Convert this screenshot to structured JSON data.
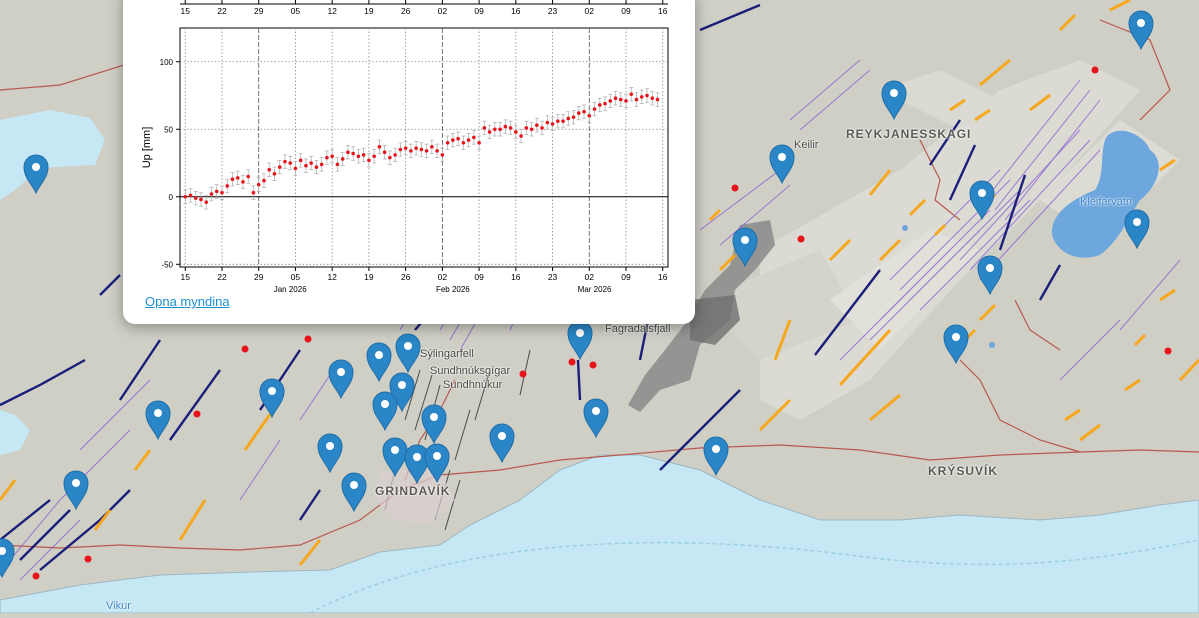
{
  "map": {
    "place_labels": [
      {
        "name": "REYKJANESSKAGI",
        "kind": "region"
      },
      {
        "name": "Keilir",
        "kind": "small"
      },
      {
        "name": "Kleifarvatn",
        "kind": "water"
      },
      {
        "name": "KRÝSUVÍK",
        "kind": "region"
      },
      {
        "name": "GRINDAVÍK",
        "kind": "region"
      },
      {
        "name": "Sýlingarfell",
        "kind": "small"
      },
      {
        "name": "Sundhnúksgígar",
        "kind": "small"
      },
      {
        "name": "Sundhnúkur",
        "kind": "small"
      },
      {
        "name": "Fagradalsfjall",
        "kind": "small"
      },
      {
        "name": "Vikur",
        "kind": "water"
      }
    ],
    "colors": {
      "land": "#cfcfc6",
      "sea": "#c6e8f5",
      "lake": "#6ea6de",
      "lava": "#7e7e7e",
      "fault_navy": "#1b1f7a",
      "fault_purple": "#8b5fd3",
      "fissure_orange": "#f7a71b",
      "road": "#b8584e",
      "quake_dot": "#e8141b",
      "marker": "#2a86c6"
    },
    "markers_icon": "map-marker-icon"
  },
  "popup": {
    "link_text": "Opna myndina",
    "chart_data": {
      "type": "scatter",
      "title": "",
      "xlabel": "",
      "ylabel": "Up [mm]",
      "ylim": [
        -52,
        125
      ],
      "yticks": [
        -50,
        0,
        50,
        100
      ],
      "xlim_days": [
        -1,
        76
      ],
      "x_day_ticks": [
        {
          "label": "15",
          "day": 0
        },
        {
          "label": "22",
          "day": 7
        },
        {
          "label": "29",
          "day": 14
        },
        {
          "label": "05",
          "day": 21
        },
        {
          "label": "12",
          "day": 28
        },
        {
          "label": "19",
          "day": 35
        },
        {
          "label": "26",
          "day": 42
        },
        {
          "label": "02",
          "day": 49
        },
        {
          "label": "09",
          "day": 56
        },
        {
          "label": "16",
          "day": 63
        },
        {
          "label": "23",
          "day": 70
        },
        {
          "label": "02",
          "day": 77
        },
        {
          "label": "09",
          "day": 84
        },
        {
          "label": "16",
          "day": 91
        }
      ],
      "month_labels": [
        {
          "label": "Jan 2026",
          "day": 20
        },
        {
          "label": "Feb 2026",
          "day": 51
        },
        {
          "label": "Mar 2026",
          "day": 78
        }
      ],
      "start_date": "2025-12-15",
      "series": [
        {
          "name": "",
          "color": "#e8141b",
          "error_mm": 5,
          "points": [
            [
              1,
              0
            ],
            [
              2,
              1
            ],
            [
              3,
              -1
            ],
            [
              4,
              -2
            ],
            [
              5,
              -4
            ],
            [
              6,
              2
            ],
            [
              7,
              4
            ],
            [
              8,
              3
            ],
            [
              9,
              8
            ],
            [
              10,
              13
            ],
            [
              11,
              14
            ],
            [
              12,
              11
            ],
            [
              13,
              15
            ],
            [
              14,
              3
            ],
            [
              15,
              9
            ],
            [
              16,
              12
            ],
            [
              17,
              20
            ],
            [
              18,
              17
            ],
            [
              19,
              22
            ],
            [
              20,
              26
            ],
            [
              21,
              25
            ],
            [
              22,
              21
            ],
            [
              23,
              27
            ],
            [
              24,
              23
            ],
            [
              25,
              25
            ],
            [
              26,
              22
            ],
            [
              27,
              24
            ],
            [
              28,
              29
            ],
            [
              29,
              30
            ],
            [
              30,
              24
            ],
            [
              31,
              28
            ],
            [
              32,
              33
            ],
            [
              33,
              32
            ],
            [
              34,
              30
            ],
            [
              35,
              31
            ],
            [
              36,
              27
            ],
            [
              37,
              30
            ],
            [
              38,
              37
            ],
            [
              39,
              33
            ],
            [
              40,
              29
            ],
            [
              41,
              31
            ],
            [
              42,
              35
            ],
            [
              43,
              36
            ],
            [
              44,
              34
            ],
            [
              45,
              36
            ],
            [
              46,
              35
            ],
            [
              47,
              34
            ],
            [
              48,
              37
            ],
            [
              49,
              34
            ],
            [
              50,
              31
            ],
            [
              51,
              40
            ],
            [
              52,
              42
            ],
            [
              53,
              43
            ],
            [
              54,
              40
            ],
            [
              55,
              42
            ],
            [
              56,
              44
            ],
            [
              57,
              40
            ],
            [
              58,
              51
            ],
            [
              59,
              48
            ],
            [
              60,
              50
            ],
            [
              61,
              50
            ],
            [
              62,
              52
            ],
            [
              63,
              51
            ],
            [
              64,
              48
            ],
            [
              65,
              45
            ],
            [
              66,
              51
            ],
            [
              67,
              50
            ],
            [
              68,
              53
            ],
            [
              69,
              51
            ],
            [
              70,
              55
            ],
            [
              71,
              54
            ],
            [
              72,
              56
            ],
            [
              73,
              56
            ],
            [
              74,
              58
            ],
            [
              75,
              59
            ],
            [
              76,
              62
            ],
            [
              77,
              63
            ],
            [
              78,
              60
            ],
            [
              79,
              65
            ],
            [
              80,
              68
            ],
            [
              81,
              69
            ],
            [
              82,
              71
            ],
            [
              83,
              73
            ],
            [
              84,
              72
            ],
            [
              85,
              71
            ],
            [
              86,
              76
            ],
            [
              87,
              72
            ],
            [
              88,
              74
            ],
            [
              89,
              75
            ],
            [
              90,
              73
            ],
            [
              91,
              72
            ]
          ]
        }
      ]
    }
  }
}
